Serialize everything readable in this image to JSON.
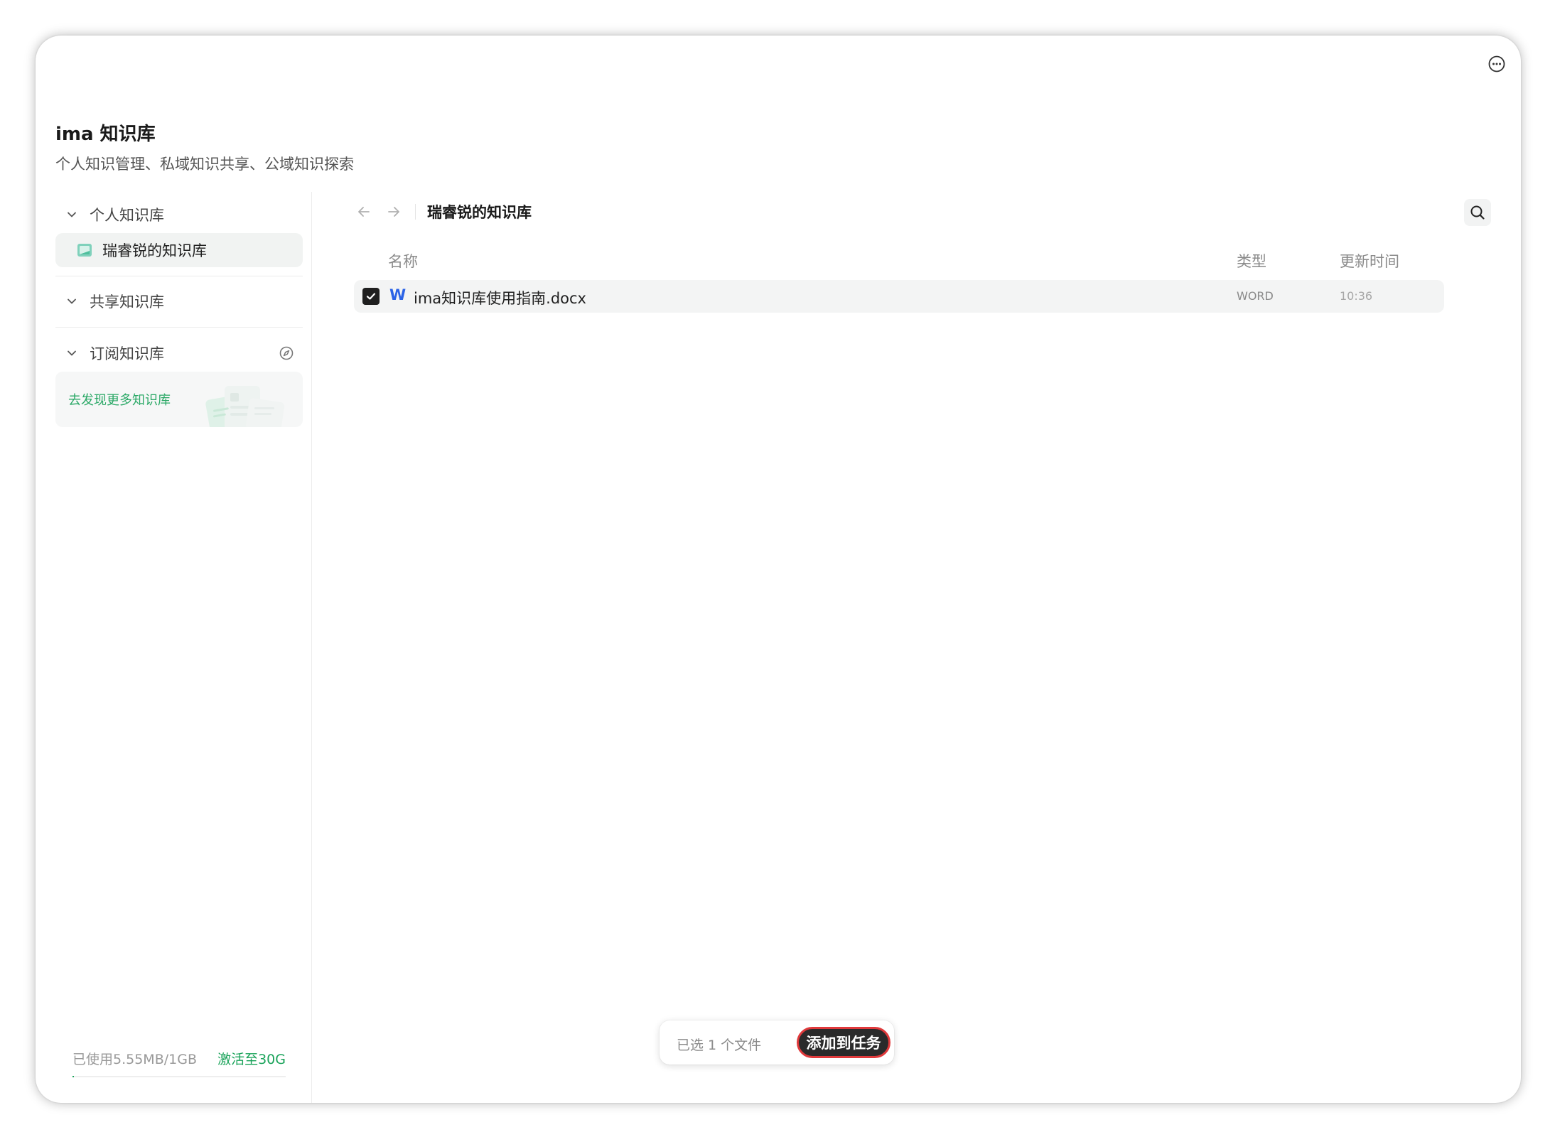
{
  "app": {
    "title": "ima 知识库",
    "subtitle": "个人知识管理、私域知识共享、公域知识探索"
  },
  "sidebar": {
    "personal": {
      "label": "个人知识库",
      "items": [
        {
          "label": "瑞睿锐的知识库",
          "icon": "knowledge-base-icon",
          "selected": true
        }
      ]
    },
    "shared": {
      "label": "共享知识库"
    },
    "subscribed": {
      "label": "订阅知识库",
      "icon": "compass-icon",
      "discover_label": "去发现更多知识库"
    },
    "storage": {
      "used_label": "已使用5.55MB/1GB",
      "activate_label": "激活至30G",
      "used_fraction": 0.0054
    }
  },
  "main": {
    "breadcrumb": "瑞睿锐的知识库",
    "columns": {
      "name": "名称",
      "type": "类型",
      "updated": "更新时间"
    },
    "files": [
      {
        "name": "ima知识库使用指南.docx",
        "type": "WORD",
        "updated": "10:36",
        "checked": true,
        "icon_letter": "W"
      }
    ]
  },
  "bottom_bar": {
    "selection_label": "已选 1 个文件",
    "add_button_label": "添加到任务"
  },
  "colors": {
    "accent_green": "#1aa35a",
    "word_blue": "#2b63e6",
    "button_dark": "#2a2a2a",
    "button_ring": "#e0393b"
  }
}
